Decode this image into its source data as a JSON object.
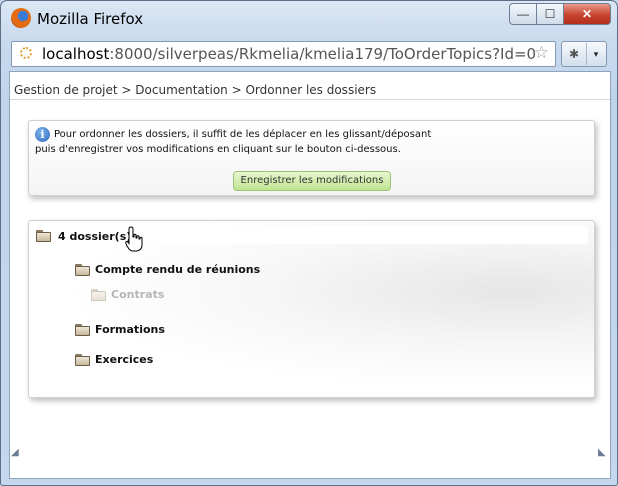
{
  "window": {
    "title": "Mozilla Firefox",
    "controls": {
      "minimize": "—",
      "maximize": "☐",
      "close": "✕"
    }
  },
  "navbar": {
    "url_host": "localhost",
    "url_rest": ":8000/silverpeas/Rkmelia/kmelia179/ToOrderTopics?Id=0",
    "bookmark_icon": "star-icon",
    "addon_arrow": "▾"
  },
  "page": {
    "breadcrumb": "Gestion de projet > Documentation > Ordonner les dossiers",
    "info": {
      "line1": "Pour ordonner les dossiers, il suffit de les déplacer en les glissant/déposant",
      "line2": "puis d'enregistrer vos modifications en cliquant sur le bouton ci-dessous.",
      "button": "Enregistrer les modifications"
    },
    "tree": {
      "root": "4 dossier(s)",
      "folders": [
        {
          "label": "Compte rendu de réunions"
        },
        {
          "label": "Contrats",
          "dragging": true
        },
        {
          "label": "Formations"
        },
        {
          "label": "Exercices"
        }
      ]
    }
  },
  "colors": {
    "button_green": "#bfe38f",
    "close_red": "#c6432e",
    "window_frame": "#c9daee"
  }
}
